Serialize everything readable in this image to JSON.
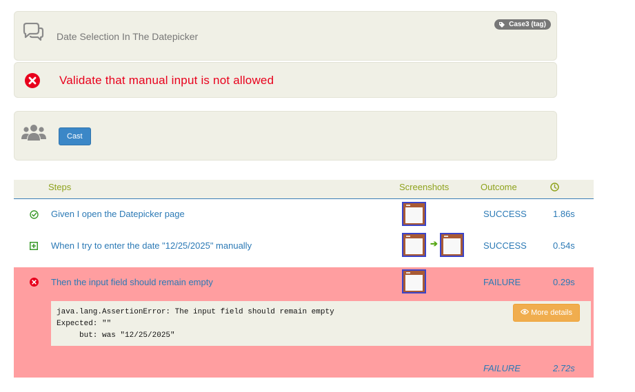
{
  "feature": {
    "title": "Date Selection In The Datepicker",
    "tag": "Case3 (tag)",
    "icon": "comments-icon"
  },
  "scenario": {
    "title": "Validate that manual input is not allowed",
    "icon": "error-circle-icon",
    "color": "#e8001c"
  },
  "cast": {
    "icon": "users-icon",
    "button_label": "Cast"
  },
  "steps_table": {
    "headers": {
      "steps": "Steps",
      "screenshots": "Screenshots",
      "outcome": "Outcome",
      "duration_icon": "clock-icon"
    },
    "rows": [
      {
        "status_icon": "check-circle-icon",
        "text": "Given I open the Datepicker page",
        "outcome": "SUCCESS",
        "duration": "1.86s",
        "screenshots": 1
      },
      {
        "status_icon": "plus-square-icon",
        "text": "When I try to enter the date \"12/25/2025\" manually",
        "outcome": "SUCCESS",
        "duration": "0.54s",
        "screenshots": 2
      },
      {
        "status_icon": "error-circle-icon",
        "text": "Then the input field should remain empty",
        "outcome": "FAILURE",
        "duration": "0.29s",
        "screenshots": 1
      }
    ],
    "error": {
      "text": "java.lang.AssertionError: The input field should remain empty\nExpected: \"\"\n     but: was \"12/25/2025\"",
      "button_label": "More details",
      "button_icon": "eye-icon"
    },
    "summary": {
      "outcome": "FAILURE",
      "duration": "2.72s"
    }
  },
  "colors": {
    "panel_bg": "#f0f0e6",
    "header_text": "#8ea21c",
    "link_text": "#2b79b5",
    "failure_bg": "#ff9ea0",
    "error_red": "#e8001c",
    "success_green": "#3a9a2a",
    "primary_button": "#3b87c7",
    "warning_button": "#f0ad4e"
  }
}
